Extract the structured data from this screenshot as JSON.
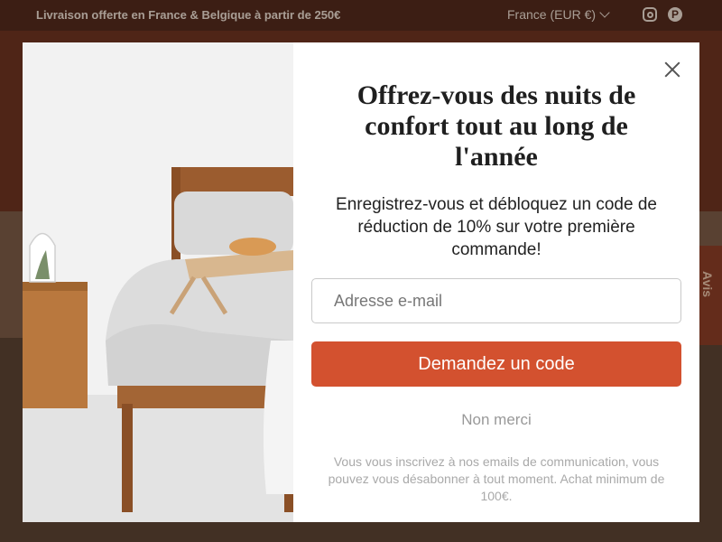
{
  "announcement": {
    "text": "Livraison offerte en France & Belgique à partir de 250€"
  },
  "header": {
    "country_label": "France (EUR €)",
    "social": [
      "instagram-icon",
      "pinterest-icon"
    ]
  },
  "side_tab": {
    "label": "Avis"
  },
  "modal": {
    "title": "Offrez-vous des nuits de confort tout au long de l'année",
    "description": "Enregistrez-vous et débloquez un code de réduction de 10% sur votre première commande!",
    "email_placeholder": "Adresse e-mail",
    "submit_label": "Demandez un code",
    "decline_label": "Non merci",
    "disclaimer": "Vous vous inscrivez à nos emails de communication, vous pouvez vous désabonner à tout moment. Achat minimum de 100€."
  },
  "colors": {
    "accent": "#d3512f",
    "announce_bg": "#4d2418",
    "header_bg": "#6a2e1c"
  }
}
